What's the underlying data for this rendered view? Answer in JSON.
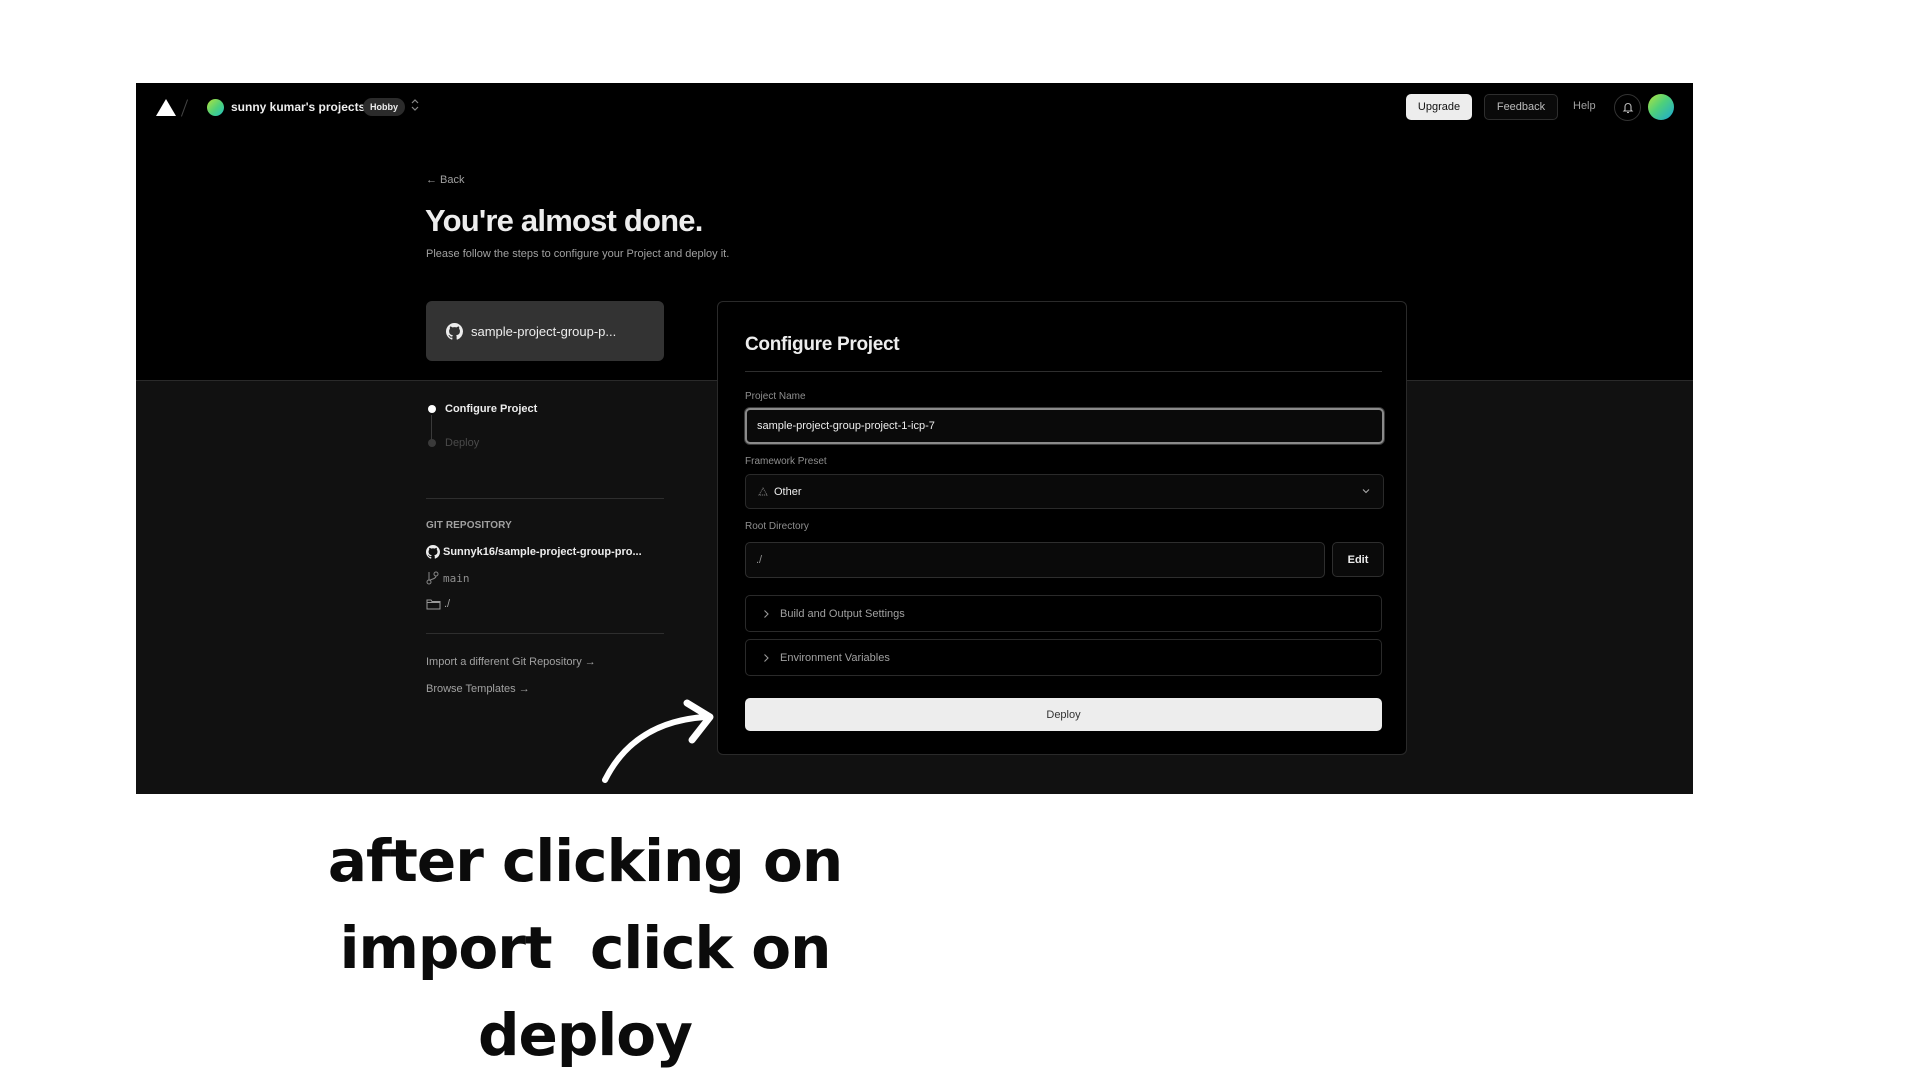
{
  "nav": {
    "team_name": "sunny kumar's projects",
    "plan_badge": "Hobby",
    "upgrade_label": "Upgrade",
    "feedback_label": "Feedback",
    "help_label": "Help"
  },
  "header": {
    "back_label": "← Back",
    "title": "You're almost done.",
    "subtitle": "Please follow the steps to configure your Project and deploy it."
  },
  "repo_card": {
    "name": "sample-project-group-p..."
  },
  "steps": [
    {
      "label": "Configure Project",
      "state": "active"
    },
    {
      "label": "Deploy",
      "state": "inactive"
    }
  ],
  "git": {
    "heading": "GIT REPOSITORY",
    "repo": "Sunnyk16/sample-project-group-pro...",
    "branch": "main",
    "directory": "./"
  },
  "links": {
    "import_different": "Import a different Git Repository →",
    "browse_templates": "Browse Templates →"
  },
  "configure": {
    "title": "Configure Project",
    "project_name_label": "Project Name",
    "project_name_value": "sample-project-group-project-1-icp-7",
    "framework_label": "Framework Preset",
    "framework_value": "Other",
    "root_label": "Root Directory",
    "root_value": "./",
    "edit_label": "Edit",
    "build_settings_label": "Build and Output Settings",
    "env_vars_label": "Environment Variables",
    "deploy_label": "Deploy"
  },
  "annotation": {
    "lines": [
      "after clicking on",
      "import  click on",
      "deploy"
    ]
  }
}
